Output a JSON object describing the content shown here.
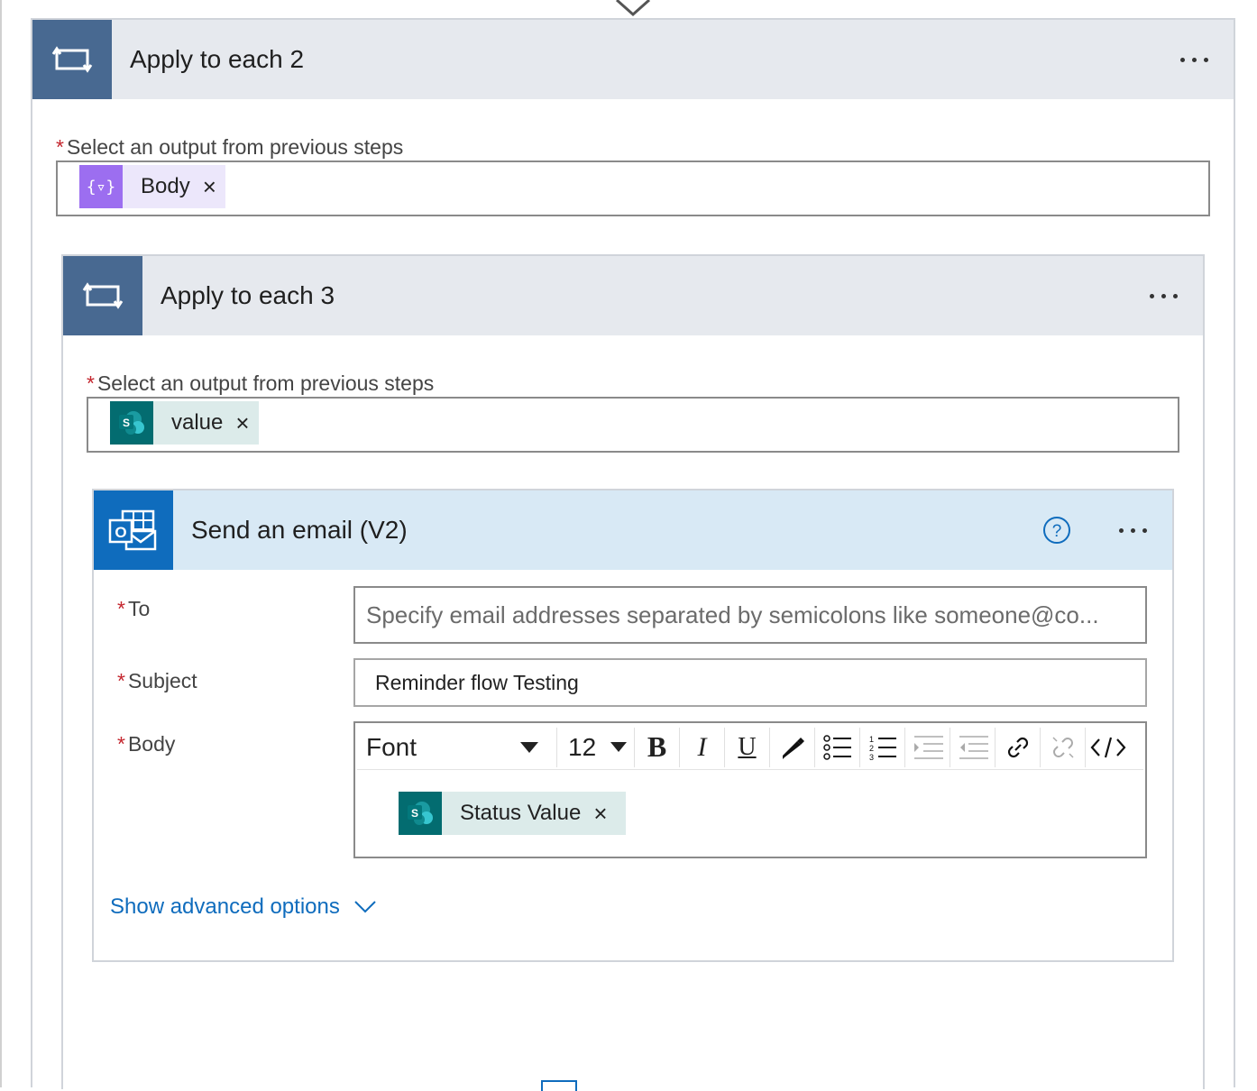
{
  "loop_outer": {
    "title": "Apply to each 2",
    "icon": "loop-icon",
    "more_icon": "more-options-icon",
    "output_label": "Select an output from previous steps",
    "required_mark": "*",
    "token": {
      "label": "Body",
      "icon": "expression-icon",
      "remove": "×"
    }
  },
  "loop_inner": {
    "title": "Apply to each 3",
    "icon": "loop-icon",
    "more_icon": "more-options-icon",
    "output_label": "Select an output from previous steps",
    "required_mark": "*",
    "token": {
      "label": "value",
      "icon": "sharepoint-icon",
      "remove": "×"
    }
  },
  "email_action": {
    "title": "Send an email (V2)",
    "icon": "outlook-icon",
    "help_icon": "help-icon",
    "more_icon": "more-options-icon",
    "to": {
      "label": "To",
      "required_mark": "*",
      "placeholder": "Specify email addresses separated by semicolons like someone@co..."
    },
    "subject": {
      "label": "Subject",
      "required_mark": "*",
      "value": "Reminder flow Testing"
    },
    "body": {
      "label": "Body",
      "required_mark": "*",
      "toolbar": {
        "font": "Font",
        "font_size": "12",
        "bold": "B",
        "italic": "I",
        "underline": "U",
        "buttons": [
          "font-color-icon",
          "bulleted-list-icon",
          "numbered-list-icon",
          "indent-icon",
          "outdent-icon",
          "link-icon",
          "unlink-icon",
          "code-view-icon"
        ]
      },
      "token": {
        "label": "Status Value",
        "icon": "sharepoint-icon",
        "remove": "×"
      }
    },
    "advanced_link": "Show advanced options"
  },
  "colors": {
    "loop_header_bg": "#e6e9ee",
    "loop_icon_bg": "#486991",
    "email_header_bg": "#d8e9f5",
    "outlook_blue": "#0f6cbd",
    "sharepoint_teal": "#036c70",
    "expression_purple": "#9c6ef0",
    "required_red": "#c4262e"
  }
}
